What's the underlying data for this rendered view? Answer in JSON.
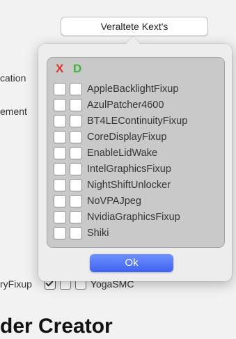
{
  "background": {
    "left_labels": [
      "cation",
      "ement"
    ],
    "row_label": "ryFixup",
    "row_item": "YogaSMC",
    "window_title": "der Creator"
  },
  "top_button": {
    "label": "Veraltete Kext's"
  },
  "popover": {
    "header_x": "X",
    "header_d": "D",
    "items": [
      {
        "label": "AppleBacklightFixup"
      },
      {
        "label": "AzulPatcher4600"
      },
      {
        "label": "BT4LEContinuityFixup"
      },
      {
        "label": "CoreDisplayFixup"
      },
      {
        "label": "EnableLidWake"
      },
      {
        "label": "IntelGraphicsFixup"
      },
      {
        "label": "NightShiftUnlocker"
      },
      {
        "label": "NoVPAJpeg"
      },
      {
        "label": "NvidiaGraphicsFixup"
      },
      {
        "label": "Shiki"
      }
    ],
    "ok_label": "Ok"
  },
  "colors": {
    "header_x": "#d8322a",
    "header_d": "#3fb43f",
    "ok_button": "#4f72f5"
  }
}
